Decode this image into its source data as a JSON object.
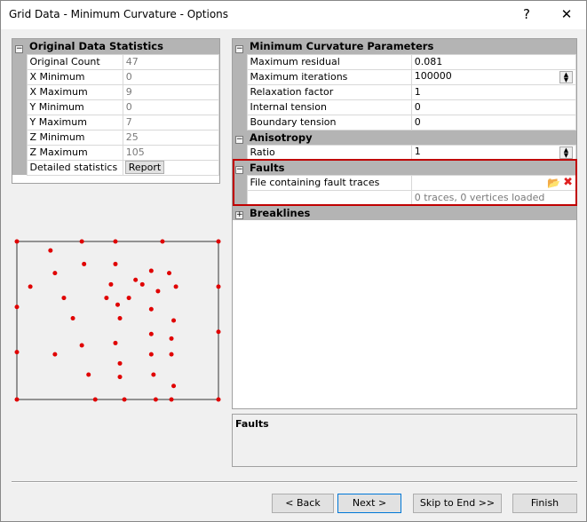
{
  "window": {
    "title": "Grid Data - Minimum Curvature - Options",
    "help": "?",
    "close": "✕"
  },
  "stats": {
    "title": "Original Data Statistics",
    "rows": [
      {
        "label": "Original Count",
        "value": "47"
      },
      {
        "label": "X Minimum",
        "value": "0"
      },
      {
        "label": "X Maximum",
        "value": "9"
      },
      {
        "label": "Y Minimum",
        "value": "0"
      },
      {
        "label": "Y Maximum",
        "value": "7"
      },
      {
        "label": "Z Minimum",
        "value": "25"
      },
      {
        "label": "Z Maximum",
        "value": "105"
      }
    ],
    "detailed_label": "Detailed statistics",
    "report_button": "Report"
  },
  "params": {
    "mc_title": "Minimum Curvature Parameters",
    "mc_rows": [
      {
        "label": "Maximum residual",
        "value": "0.081"
      },
      {
        "label": "Maximum iterations",
        "value": "100000"
      },
      {
        "label": "Relaxation factor",
        "value": "1"
      },
      {
        "label": "Internal tension",
        "value": "0"
      },
      {
        "label": "Boundary tension",
        "value": "0"
      }
    ],
    "aniso_title": "Anisotropy",
    "ratio_label": "Ratio",
    "ratio_value": "1",
    "faults_title": "Faults",
    "fault_file_label": "File containing fault traces",
    "fault_file_value": "",
    "fault_status": "0 traces, 0 vertices loaded",
    "breaklines_title": "Breaklines"
  },
  "help_panel": {
    "title": "Faults"
  },
  "buttons": {
    "back": "< Back",
    "next": "Next >",
    "skip": "Skip to End >>",
    "finish": "Finish"
  },
  "colors": {
    "point": "#e00000",
    "highlight": "#c00000"
  },
  "preview": {
    "xlim": [
      0,
      9
    ],
    "ylim": [
      0,
      7
    ],
    "points": [
      [
        0,
        7
      ],
      [
        1.5,
        6.6
      ],
      [
        2.9,
        7
      ],
      [
        4.4,
        7
      ],
      [
        6.5,
        7
      ],
      [
        9,
        7
      ],
      [
        3,
        6
      ],
      [
        4.4,
        6
      ],
      [
        1.7,
        5.6
      ],
      [
        6,
        5.7
      ],
      [
        6.8,
        5.6
      ],
      [
        0.6,
        5
      ],
      [
        4.2,
        5.1
      ],
      [
        5.3,
        5.3
      ],
      [
        6.3,
        4.8
      ],
      [
        7.1,
        5
      ],
      [
        9,
        5
      ],
      [
        2.1,
        4.5
      ],
      [
        4,
        4.5
      ],
      [
        5,
        4.5
      ],
      [
        5.6,
        5.1
      ],
      [
        4.5,
        4.2
      ],
      [
        0,
        4.1
      ],
      [
        6,
        4
      ],
      [
        2.5,
        3.6
      ],
      [
        4.6,
        3.6
      ],
      [
        7,
        3.5
      ],
      [
        9,
        3
      ],
      [
        6,
        2.9
      ],
      [
        6.9,
        2.7
      ],
      [
        0,
        2.1
      ],
      [
        1.7,
        2
      ],
      [
        2.9,
        2.4
      ],
      [
        4.4,
        2.5
      ],
      [
        6,
        2
      ],
      [
        6.9,
        2
      ],
      [
        4.6,
        1.6
      ],
      [
        3.2,
        1.1
      ],
      [
        4.6,
        1
      ],
      [
        6.1,
        1.1
      ],
      [
        7,
        0.6
      ],
      [
        0,
        0
      ],
      [
        3.5,
        0
      ],
      [
        4.8,
        0
      ],
      [
        6.2,
        0
      ],
      [
        6.9,
        0
      ],
      [
        9,
        0
      ]
    ]
  }
}
